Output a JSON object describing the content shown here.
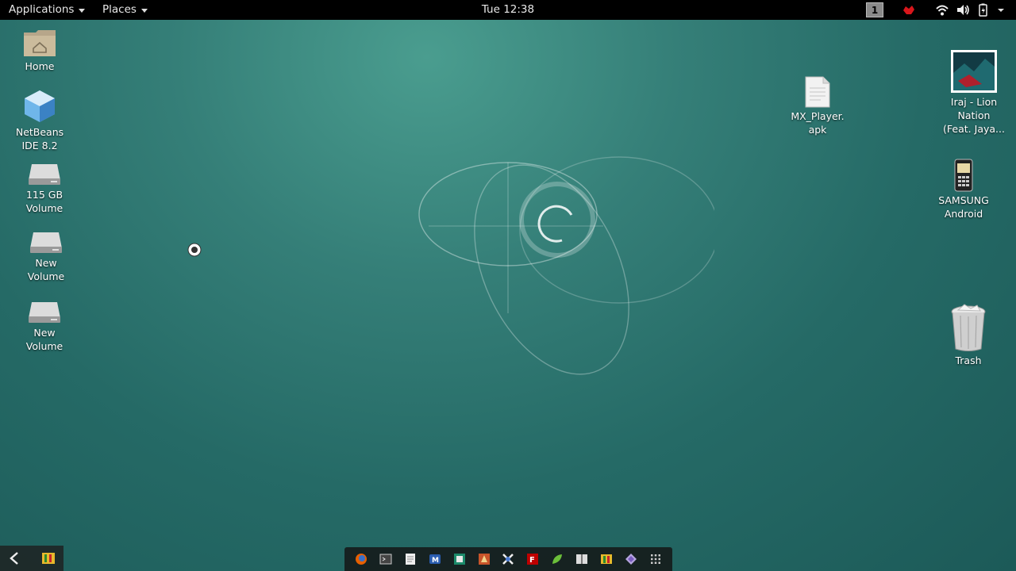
{
  "topbar": {
    "applications_label": "Applications",
    "places_label": "Places",
    "clock": "Tue 12:38",
    "workspace_number": "1",
    "tray_icons": [
      "red-app-icon",
      "wifi-icon",
      "volume-icon",
      "battery-icon",
      "system-menu-arrow-icon"
    ]
  },
  "desktop": {
    "left_icons": [
      {
        "label": "Home",
        "icon": "home-folder-icon"
      },
      {
        "label": "NetBeans\nIDE 8.2",
        "icon": "netbeans-cube-icon"
      },
      {
        "label": "115 GB\nVolume",
        "icon": "drive-icon"
      },
      {
        "label": "New\nVolume",
        "icon": "drive-icon"
      },
      {
        "label": "New\nVolume",
        "icon": "drive-icon"
      }
    ],
    "right_icons": [
      {
        "label": "MX_Player.\napk",
        "icon": "document-icon"
      },
      {
        "label": "Iraj - Lion\nNation\n(Feat. Jaya...",
        "icon": "image-thumbnail-icon"
      },
      {
        "label": "SAMSUNG\nAndroid",
        "icon": "phone-icon"
      },
      {
        "label": "Trash",
        "icon": "trash-icon"
      }
    ]
  },
  "dock": {
    "items": [
      "firefox-icon",
      "terminal-icon",
      "text-editor-icon",
      "mail-icon",
      "app-icon",
      "app-icon",
      "app-icon",
      "filezilla-icon",
      "app-icon",
      "notes-icon",
      "app-icon",
      "app-icon",
      "show-apps-grid-icon"
    ]
  },
  "colors": {
    "topbar_bg": "#000000",
    "wallpaper": "#2d7470",
    "dock_bg": "#141414"
  }
}
